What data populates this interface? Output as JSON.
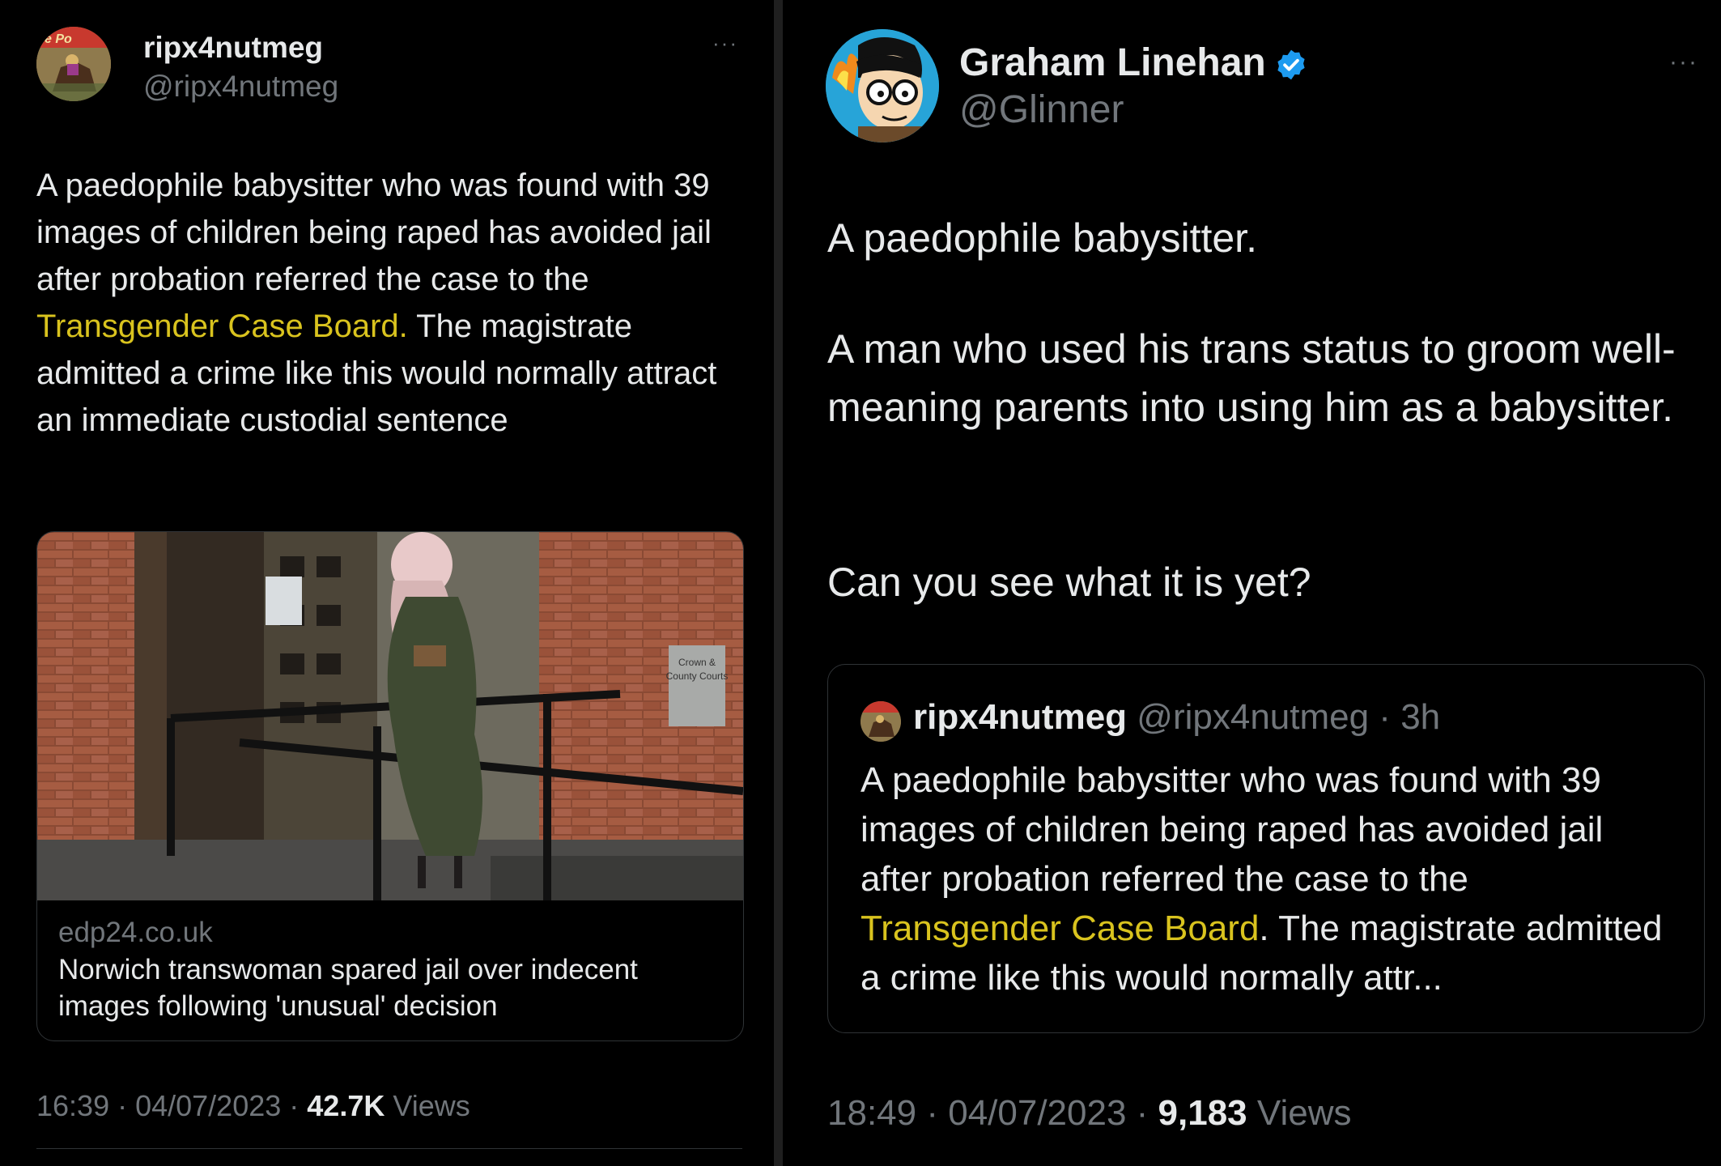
{
  "left_tweet": {
    "author_name": "ripx4nutmeg",
    "author_handle": "@ripx4nutmeg",
    "more_label": "···",
    "text_before_link": "A paedophile babysitter who was found with 39 images of children being raped has avoided jail after probation referred the case to the ",
    "link_text": "Transgender Case Board.",
    "text_after_link": " The magistrate admitted a crime like this would normally attract an immediate custodial sentence",
    "link_card": {
      "domain": "edp24.co.uk",
      "title": "Norwich transwoman spared jail over indecent images following 'unusual' decision",
      "sign_text": "Crown & County Courts"
    },
    "time": "16:39",
    "date": "04/07/2023",
    "views_count": "42.7K",
    "views_label": "Views"
  },
  "right_tweet": {
    "author_name": "Graham Linehan",
    "author_handle": "@Glinner",
    "more_label": "···",
    "paragraph_1": "A paedophile babysitter.",
    "paragraph_2": "A man who used his trans status to groom well-meaning parents into using him as a babysitter.",
    "paragraph_3": "Can you see what it is yet?",
    "quoted": {
      "author_name": "ripx4nutmeg",
      "author_handle": "@ripx4nutmeg",
      "age": "3h",
      "text_before_link": "A paedophile babysitter who was found with 39 images of children being raped has avoided jail after probation referred the case to the ",
      "link_text": "Transgender Case Board",
      "text_after_link": ". The magistrate admitted a crime like this would normally attr..."
    },
    "time": "18:49",
    "date": "04/07/2023",
    "views_count": "9,183",
    "views_label": "Views"
  },
  "colors": {
    "background": "#000000",
    "text": "#e7e9ea",
    "muted": "#71767b",
    "link": "#d9c31e",
    "verified": "#1d9bf0"
  }
}
